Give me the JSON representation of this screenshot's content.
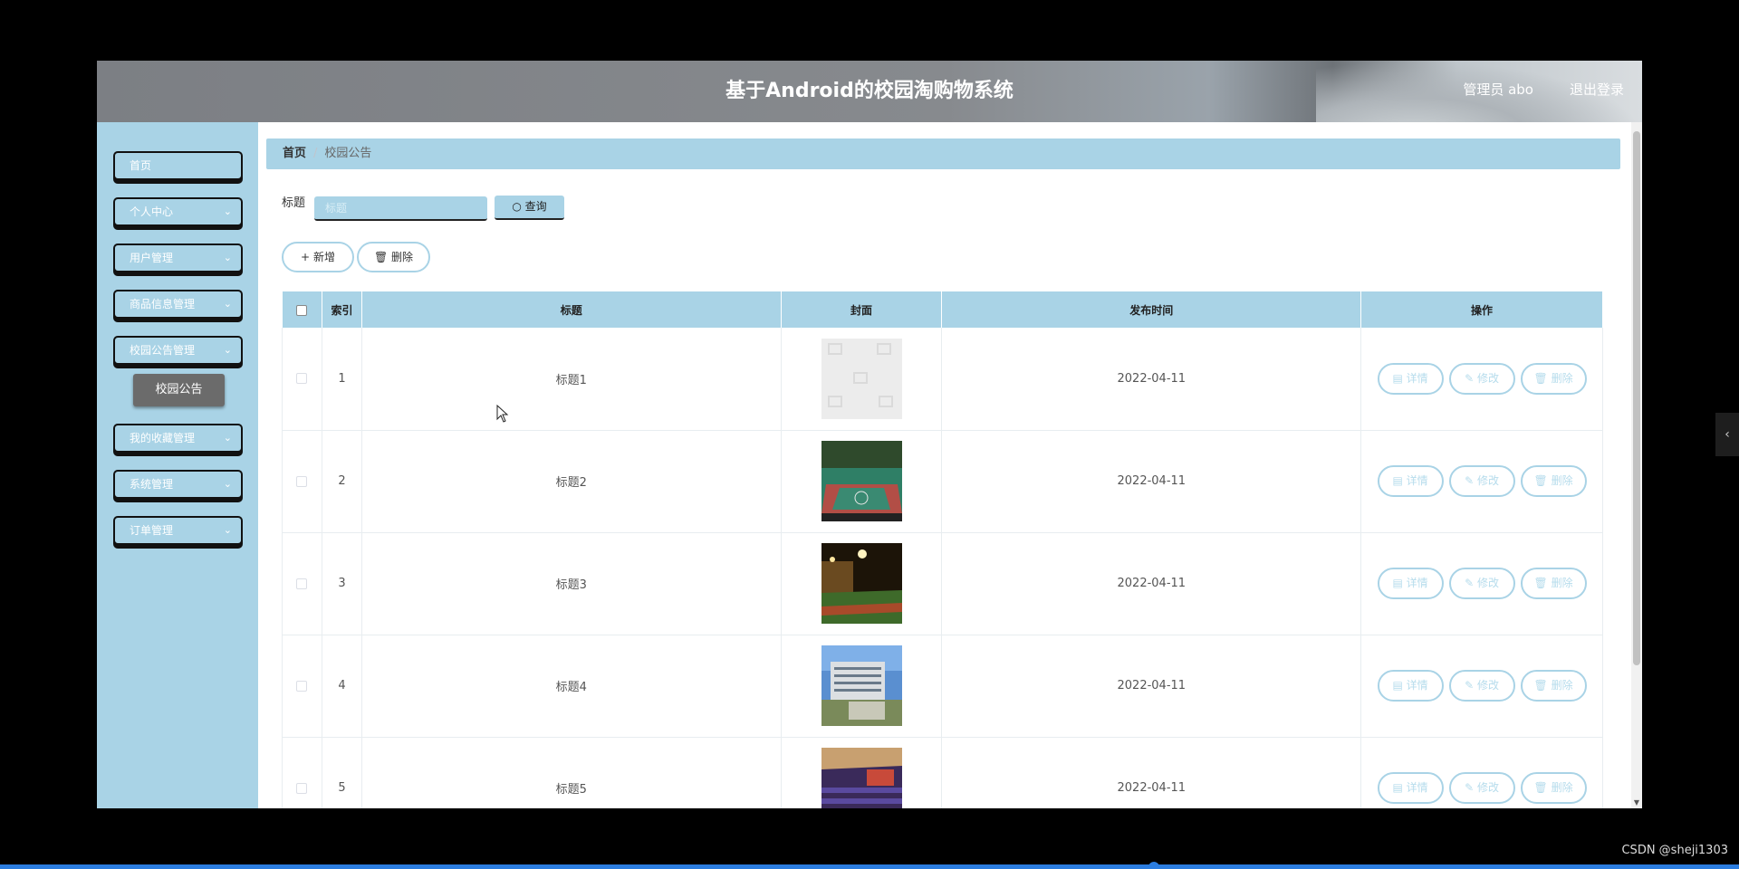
{
  "header": {
    "title": "基于Android的校园淘购物系统",
    "user": "管理员 abo",
    "logout": "退出登录"
  },
  "sidebar": {
    "items": [
      {
        "label": "首页",
        "has_children": false
      },
      {
        "label": "个人中心",
        "has_children": true
      },
      {
        "label": "用户管理",
        "has_children": true
      },
      {
        "label": "商品信息管理",
        "has_children": true
      },
      {
        "label": "校园公告管理",
        "has_children": true
      },
      {
        "label": "我的收藏管理",
        "has_children": true
      },
      {
        "label": "系统管理",
        "has_children": true
      },
      {
        "label": "订单管理",
        "has_children": true
      }
    ],
    "active_submenu": "校园公告"
  },
  "breadcrumb": {
    "home": "首页",
    "current": "校园公告"
  },
  "search": {
    "label": "标题",
    "placeholder": "标题",
    "button": "查询"
  },
  "actions": {
    "add": "新增",
    "delete": "删除"
  },
  "table": {
    "columns": [
      "索引",
      "标题",
      "封面",
      "发布时间",
      "操作"
    ],
    "rows": [
      {
        "index": "1",
        "title": "标题1",
        "date": "2022-04-11",
        "cover": "placeholder-image"
      },
      {
        "index": "2",
        "title": "标题2",
        "date": "2022-04-11",
        "cover": "basketball-court-photo"
      },
      {
        "index": "3",
        "title": "标题3",
        "date": "2022-04-11",
        "cover": "sports-field-night-photo"
      },
      {
        "index": "4",
        "title": "标题4",
        "date": "2022-04-11",
        "cover": "campus-building-photo"
      },
      {
        "index": "5",
        "title": "标题5",
        "date": "2022-04-11",
        "cover": "auditorium-photo"
      }
    ],
    "row_actions": {
      "detail": "详情",
      "edit": "修改",
      "delete": "删除"
    }
  },
  "watermark": "CSDN @sheji1303",
  "colors": {
    "accent": "#a9d3e6",
    "header": "#7c7f84",
    "submenu_active": "#6b6b6b",
    "progress": "#2b7de0"
  }
}
